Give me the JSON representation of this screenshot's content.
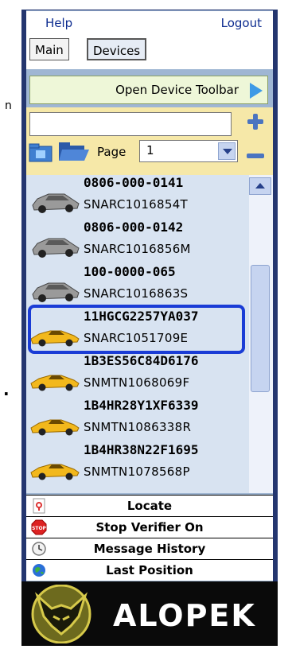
{
  "header": {
    "help_label": "Help",
    "logout_label": "Logout"
  },
  "tabs": [
    {
      "label": "Main"
    },
    {
      "label": "Devices"
    }
  ],
  "toolbar": {
    "open_device_toolbar_label": "Open Device Toolbar"
  },
  "search": {
    "value": ""
  },
  "pager": {
    "label": "Page",
    "selected": "1"
  },
  "devices": [
    {
      "id": "0806-000-0141",
      "serial": "SNARC1016854T",
      "icon": "silver-car-icon"
    },
    {
      "id": "0806-000-0142",
      "serial": "SNARC1016856M",
      "icon": "silver-car-icon"
    },
    {
      "id": "100-0000-065",
      "serial": "SNARC1016863S",
      "icon": "silver-car-icon"
    },
    {
      "id": "11HGCG2257YA037",
      "serial": "SNARC1051709E",
      "icon": "yellow-car-icon"
    },
    {
      "id": "1B3ES56C84D6176",
      "serial": "SNMTN1068069F",
      "icon": "yellow-car-icon"
    },
    {
      "id": "1B4HR28Y1XF6339",
      "serial": "SNMTN1086338R",
      "icon": "yellow-car-icon"
    },
    {
      "id": "1B4HR38N22F1695",
      "serial": "SNMTN1078568P",
      "icon": "yellow-car-icon"
    }
  ],
  "actions": [
    {
      "label": "Locate",
      "icon": "locate-icon"
    },
    {
      "label": "Stop Verifier On",
      "icon": "stop-sign-icon"
    },
    {
      "label": "Message History",
      "icon": "clock-icon"
    },
    {
      "label": "Last Position",
      "icon": "globe-icon"
    }
  ],
  "logo": {
    "text": "ALOPEK"
  },
  "fragments": {
    "left_top": "n",
    "left_bottom": "."
  },
  "colors": {
    "frame": "#24366f",
    "list_bg": "#d8e3f1",
    "highlight": "#1a3cd6",
    "link": "#0c2b8f"
  }
}
